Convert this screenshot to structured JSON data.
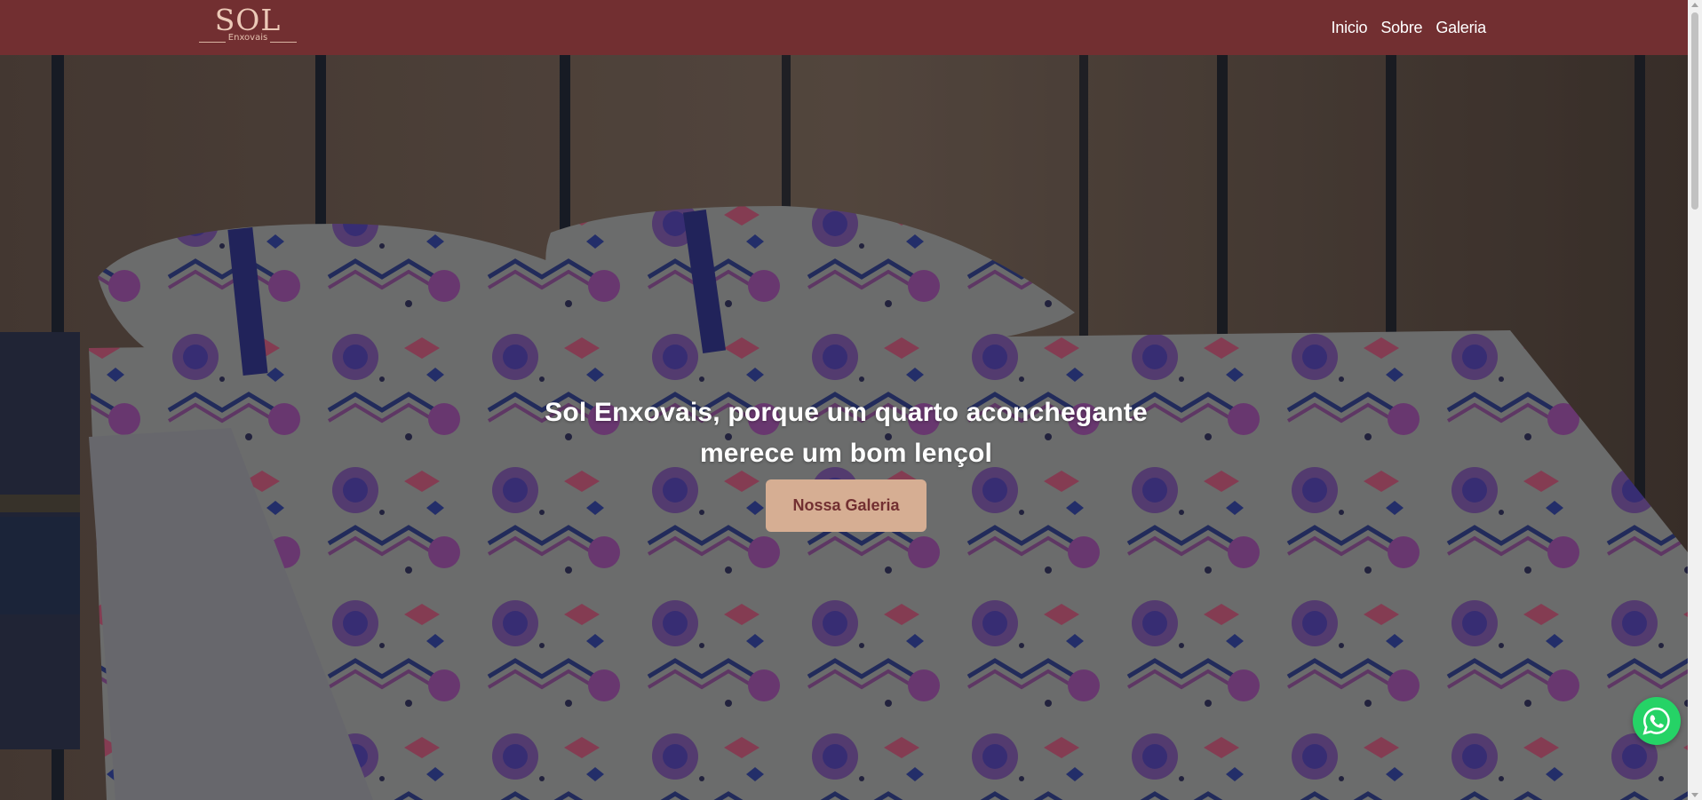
{
  "brand": {
    "name": "SOL",
    "tagline": "Enxovais"
  },
  "nav": {
    "items": [
      {
        "label": "Inicio"
      },
      {
        "label": "Sobre"
      },
      {
        "label": "Galeria"
      }
    ]
  },
  "hero": {
    "title_line1": "Sol Enxovais, porque um quarto aconchegante",
    "title_line2": "merece um bom lençol",
    "cta_label": "Nossa Galeria"
  },
  "colors": {
    "navbar": "#722f31",
    "cta_background": "#d6ae93",
    "cta_text": "#722f31",
    "whatsapp": "#25d366"
  },
  "icons": {
    "whatsapp": "whatsapp-icon"
  }
}
